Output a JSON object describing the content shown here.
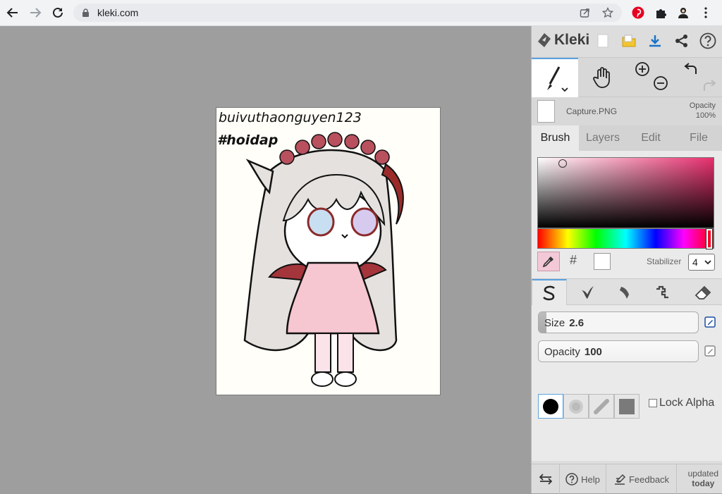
{
  "browser": {
    "url": "kleki.com",
    "back_icon": "arrow-left-icon",
    "forward_icon": "arrow-right-icon",
    "reload_icon": "reload-icon",
    "lock_icon": "lock-icon",
    "share_icon": "share-icon",
    "star_icon": "star-icon",
    "extensions": [
      "pinterest-icon",
      "puzzle-icon",
      "profile-icon",
      "kebab-menu-icon"
    ]
  },
  "canvas": {
    "handwriting_line1": "buivuthaonguyen123",
    "handwriting_line2": "#hoidap"
  },
  "app": {
    "brand": "Kleki",
    "top_icons": [
      "new-image-icon",
      "open-folder-icon",
      "download-icon",
      "share-icon",
      "help-icon"
    ]
  },
  "tools": [
    "brush-tool-icon",
    "hand-tool-icon",
    "zoom-in-icon",
    "zoom-out-icon",
    "undo-icon",
    "redo-icon"
  ],
  "layer": {
    "filename": "Capture.PNG",
    "opacity_label": "Opacity",
    "opacity_value": "100%"
  },
  "tabs": [
    {
      "label": "Brush",
      "active": true
    },
    {
      "label": "Layers",
      "active": false
    },
    {
      "label": "Edit",
      "active": false
    },
    {
      "label": "File",
      "active": false
    }
  ],
  "color": {
    "hue_color": "#e8306f",
    "current": "#ffffff",
    "hex_symbol": "#",
    "stabilizer_label": "Stabilizer",
    "stabilizer_value": "4"
  },
  "brush_types": [
    "pen-brush-icon",
    "blend-brush-icon",
    "sketchy-brush-icon",
    "pixel-brush-icon",
    "eraser-icon"
  ],
  "size": {
    "label": "Size",
    "value": "2.6",
    "fraction": 0.05
  },
  "opacity": {
    "label": "Opacity",
    "value": "100",
    "fraction": 1.0
  },
  "lock_alpha": "Lock Alpha",
  "footer": {
    "help": "Help",
    "feedback": "Feedback",
    "updated_line1": "updated",
    "updated_line2": "today"
  }
}
